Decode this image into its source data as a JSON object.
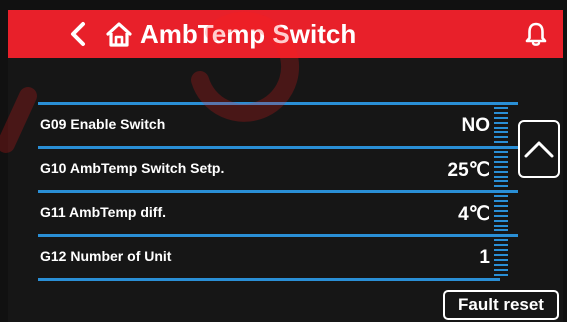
{
  "header": {
    "title": "AmbTemp Switch",
    "back_icon": "chevron-left-icon",
    "home_icon": "home-icon",
    "alarm_icon": "bell-icon",
    "background_color": "#e8202a"
  },
  "parameters": [
    {
      "label": "G09 Enable Switch",
      "value": "NO"
    },
    {
      "label": "G10 AmbTemp Switch Setp.",
      "value": "25℃"
    },
    {
      "label": "G11 AmbTemp diff.",
      "value": "4℃"
    },
    {
      "label": "G12 Number of Unit",
      "value": "1"
    }
  ],
  "scroll": {
    "up_icon": "chevron-up-icon"
  },
  "actions": {
    "fault_reset_label": "Fault reset"
  },
  "colors": {
    "accent_line": "#2a8fd6",
    "background": "#161616"
  }
}
